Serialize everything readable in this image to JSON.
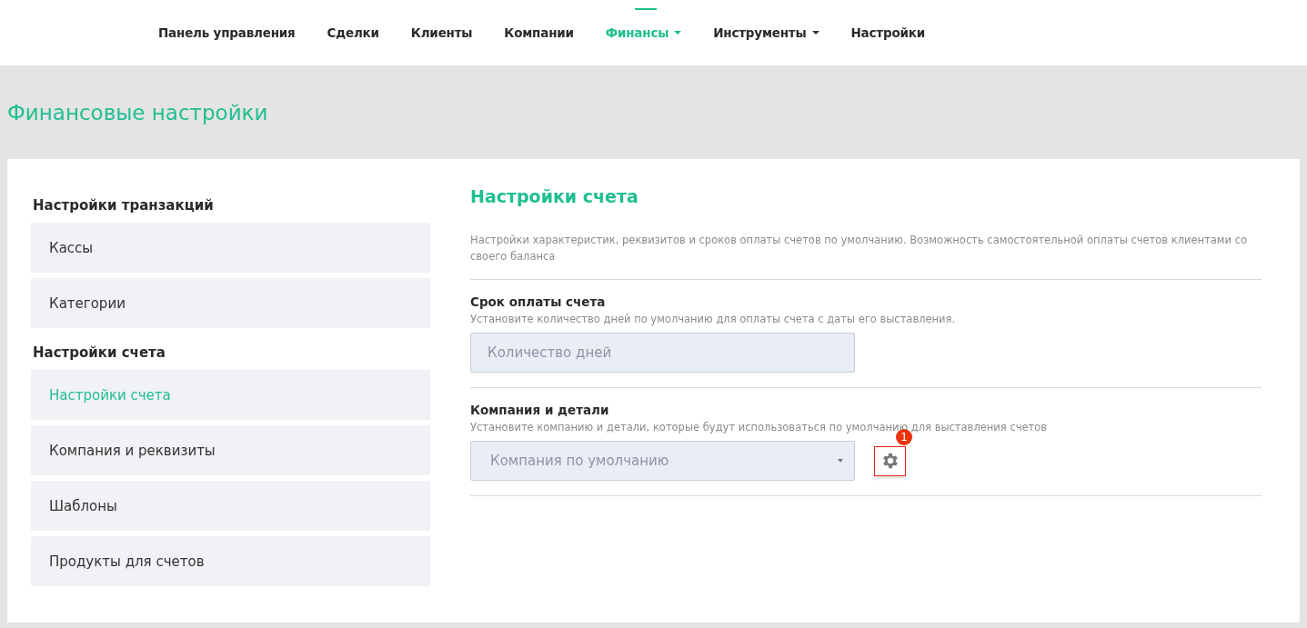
{
  "nav": [
    {
      "label": "Панель управления",
      "selected": false,
      "dropdown": false
    },
    {
      "label": "Сделки",
      "selected": false,
      "dropdown": false
    },
    {
      "label": "Клиенты",
      "selected": false,
      "dropdown": false
    },
    {
      "label": "Компании",
      "selected": false,
      "dropdown": false
    },
    {
      "label": "Финансы",
      "selected": true,
      "dropdown": true
    },
    {
      "label": "Инструменты",
      "selected": false,
      "dropdown": true
    },
    {
      "label": "Настройки",
      "selected": false,
      "dropdown": false
    }
  ],
  "page_title": "Финансовые настройки",
  "sidebar": [
    {
      "heading": "Настройки транзакций",
      "items": [
        {
          "label": "Кассы",
          "selected": false
        },
        {
          "label": "Категории",
          "selected": false
        }
      ]
    },
    {
      "heading": "Настройки счета",
      "items": [
        {
          "label": "Настройки счета",
          "selected": true
        },
        {
          "label": "Компания и реквизиты",
          "selected": false
        },
        {
          "label": "Шаблоны",
          "selected": false
        },
        {
          "label": "Продукты для счетов",
          "selected": false
        }
      ]
    }
  ],
  "content": {
    "title": "Настройки счета",
    "description": "Настройки характеристик, реквизитов и сроков оплаты счетов по умолчанию. Возможность самостоятельной оплаты счетов клиентами со своего баланса",
    "sections": [
      {
        "kind": "input",
        "title": "Срок оплаты счета",
        "hint": "Установите количество дней по умолчанию для оплаты счета с даты его выставления.",
        "placeholder": "Количество дней"
      },
      {
        "kind": "select",
        "title": "Компания и детали",
        "hint": "Установите компанию и детали, которые будут использоваться по умолчанию для выставления счетов",
        "placeholder": "Компания по умолчанию",
        "badge": "1"
      }
    ]
  }
}
